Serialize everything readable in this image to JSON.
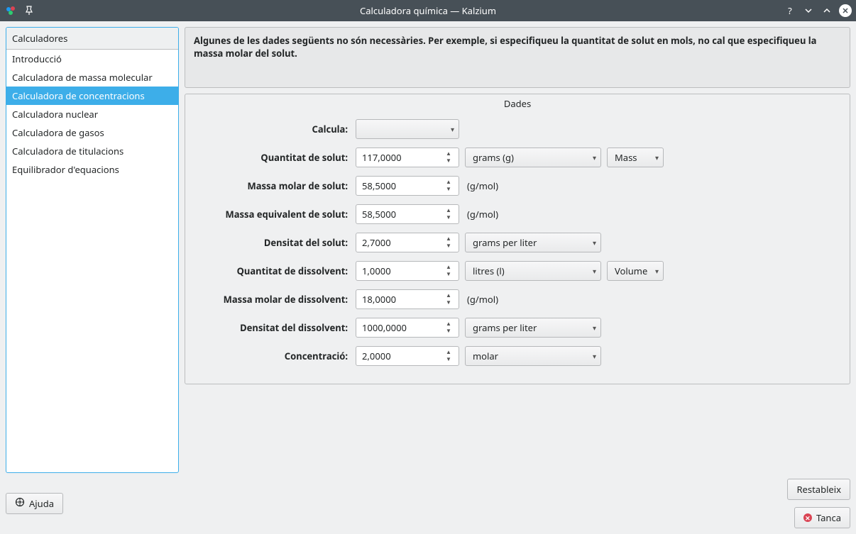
{
  "window": {
    "title": "Calculadora química — Kalzium"
  },
  "sidebar": {
    "header": "Calculadores",
    "items": [
      {
        "label": "Introducció"
      },
      {
        "label": "Calculadora de massa molecular"
      },
      {
        "label": "Calculadora de concentracions",
        "selected": true
      },
      {
        "label": "Calculadora nuclear"
      },
      {
        "label": "Calculadora de gasos"
      },
      {
        "label": "Calculadora de titulacions"
      },
      {
        "label": "Equilibrador d'equacions"
      }
    ]
  },
  "info": "Algunes de les dades següents no són necessàries. Per exemple, si especifiqueu la quantitat de solut en mols, no cal que especifiqueu la massa molar del solut.",
  "group": {
    "title": "Dades",
    "rows": {
      "calc": {
        "label": "Calcula:",
        "value": ""
      },
      "amtSolute": {
        "label": "Quantitat de solut:",
        "value": "117,0000",
        "unit": "grams (g)",
        "dim": "Mass"
      },
      "mmSolute": {
        "label": "Massa molar de solut:",
        "value": "58,5000",
        "unit": "(g/mol)"
      },
      "meSolute": {
        "label": "Massa equivalent de solut:",
        "value": "58,5000",
        "unit": "(g/mol)"
      },
      "denSolute": {
        "label": "Densitat del solut:",
        "value": "2,7000",
        "unit": "grams per liter"
      },
      "amtSolvent": {
        "label": "Quantitat de dissolvent:",
        "value": "1,0000",
        "unit": "litres (l)",
        "dim": "Volume"
      },
      "mmSolvent": {
        "label": "Massa molar de dissolvent:",
        "value": "18,0000",
        "unit": "(g/mol)"
      },
      "denSolvent": {
        "label": "Densitat del dissolvent:",
        "value": "1000,0000",
        "unit": "grams per liter"
      },
      "conc": {
        "label": "Concentració:",
        "value": "2,0000",
        "unit": "molar"
      }
    }
  },
  "buttons": {
    "help": "Ajuda",
    "reset": "Restableix",
    "close": "Tanca"
  }
}
